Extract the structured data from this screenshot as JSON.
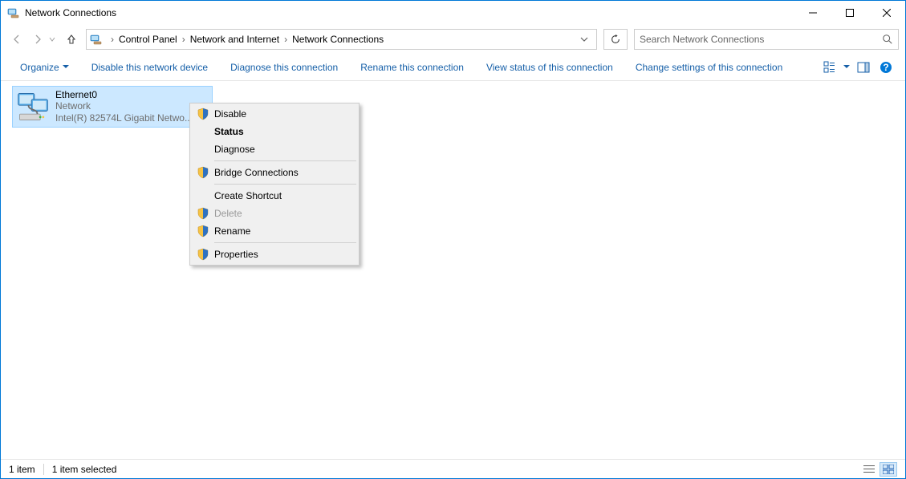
{
  "window": {
    "title": "Network Connections"
  },
  "breadcrumbs": {
    "items": [
      "Control Panel",
      "Network and Internet",
      "Network Connections"
    ]
  },
  "search": {
    "placeholder": "Search Network Connections"
  },
  "toolbar": {
    "organize": "Organize",
    "disable_device": "Disable this network device",
    "diagnose": "Diagnose this connection",
    "rename": "Rename this connection",
    "view_status": "View status of this connection",
    "change_settings": "Change settings of this connection"
  },
  "item": {
    "name": "Ethernet0",
    "line2": "Network",
    "line3": "Intel(R) 82574L Gigabit Netwo..."
  },
  "ctx": {
    "disable": "Disable",
    "status": "Status",
    "diagnose": "Diagnose",
    "bridge": "Bridge Connections",
    "shortcut": "Create Shortcut",
    "delete": "Delete",
    "rename": "Rename",
    "properties": "Properties"
  },
  "status": {
    "count": "1 item",
    "selected": "1 item selected"
  }
}
